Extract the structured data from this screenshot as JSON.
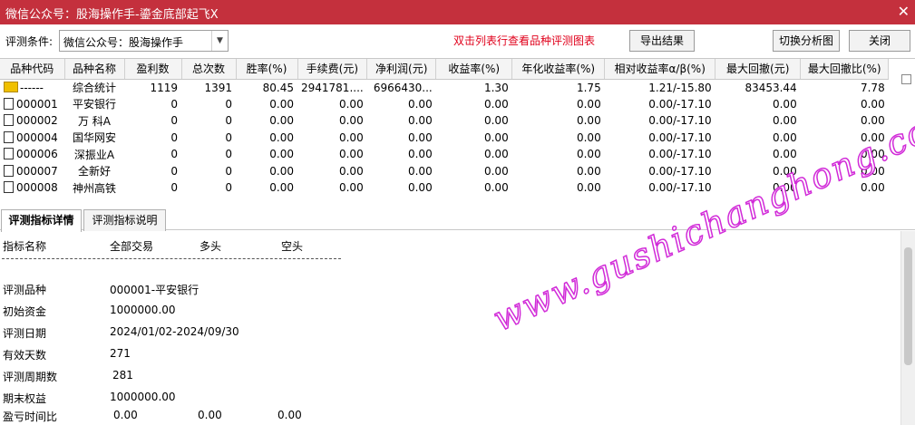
{
  "window": {
    "title": "微信公众号：股海操作手-鎏金底部起飞X",
    "close_icon": "close-icon"
  },
  "toolbar": {
    "condition_label": "评测条件:",
    "condition_value": "微信公众号：股海操作手",
    "hint": "双击列表行查看品种评测图表",
    "export_label": "导出结果",
    "switch_chart_label": "切换分析图",
    "close_label": "关闭"
  },
  "grid": {
    "columns": [
      "品种代码",
      "品种名称",
      "盈利数",
      "总次数",
      "胜率(%)",
      "手续费(元)",
      "净利润(元)",
      "收益率(%)",
      "年化收益率(%)",
      "相对收益率α/β(%)",
      "最大回撤(元)",
      "最大回撤比(%)"
    ],
    "rows": [
      {
        "code": "------",
        "name": "综合统计",
        "c2": "1119",
        "c3": "1391",
        "c4": "80.45",
        "c5": "2941781....",
        "c6": "6966430...",
        "c7": "1.30",
        "c8": "1.75",
        "c9": "1.21/-15.80",
        "c10": "83453.44",
        "c11": "7.78"
      },
      {
        "code": "000001",
        "name": "平安银行",
        "c2": "0",
        "c3": "0",
        "c4": "0.00",
        "c5": "0.00",
        "c6": "0.00",
        "c7": "0.00",
        "c8": "0.00",
        "c9": "0.00/-17.10",
        "c10": "0.00",
        "c11": "0.00"
      },
      {
        "code": "000002",
        "name": "万 科A",
        "c2": "0",
        "c3": "0",
        "c4": "0.00",
        "c5": "0.00",
        "c6": "0.00",
        "c7": "0.00",
        "c8": "0.00",
        "c9": "0.00/-17.10",
        "c10": "0.00",
        "c11": "0.00"
      },
      {
        "code": "000004",
        "name": "国华网安",
        "c2": "0",
        "c3": "0",
        "c4": "0.00",
        "c5": "0.00",
        "c6": "0.00",
        "c7": "0.00",
        "c8": "0.00",
        "c9": "0.00/-17.10",
        "c10": "0.00",
        "c11": "0.00"
      },
      {
        "code": "000006",
        "name": "深振业A",
        "c2": "0",
        "c3": "0",
        "c4": "0.00",
        "c5": "0.00",
        "c6": "0.00",
        "c7": "0.00",
        "c8": "0.00",
        "c9": "0.00/-17.10",
        "c10": "0.00",
        "c11": "0.00"
      },
      {
        "code": "000007",
        "name": "全新好",
        "c2": "0",
        "c3": "0",
        "c4": "0.00",
        "c5": "0.00",
        "c6": "0.00",
        "c7": "0.00",
        "c8": "0.00",
        "c9": "0.00/-17.10",
        "c10": "0.00",
        "c11": "0.00"
      },
      {
        "code": "000008",
        "name": "神州高铁",
        "c2": "0",
        "c3": "0",
        "c4": "0.00",
        "c5": "0.00",
        "c6": "0.00",
        "c7": "0.00",
        "c8": "0.00",
        "c9": "0.00/-17.10",
        "c10": "0.00",
        "c11": "0.00"
      }
    ]
  },
  "tabs": {
    "detail_tab": "评测指标详情",
    "explain_tab": "评测指标说明"
  },
  "detail": {
    "header": {
      "name": "指标名称",
      "all": "全部交易",
      "long": "多头",
      "short": "空头"
    },
    "rows": [
      {
        "label": "评测品种",
        "value": "000001-平安银行"
      },
      {
        "label": "初始资金",
        "value": "1000000.00"
      },
      {
        "label": "评测日期",
        "value": "2024/01/02-2024/09/30"
      },
      {
        "label": "有效天数",
        "value": "271"
      },
      {
        "label": "评测周期数",
        "value": "281"
      },
      {
        "label": "期末权益",
        "value": "1000000.00"
      }
    ],
    "profit_ratio": {
      "label": "盈亏时间比",
      "all": "0.00",
      "long": "0.00",
      "short": "0.00"
    }
  },
  "watermark": "www.gushichanghong.com",
  "colors": {
    "titlebar": "#c4303d",
    "hint": "#e0001b",
    "watermark": "#d12ad8"
  }
}
